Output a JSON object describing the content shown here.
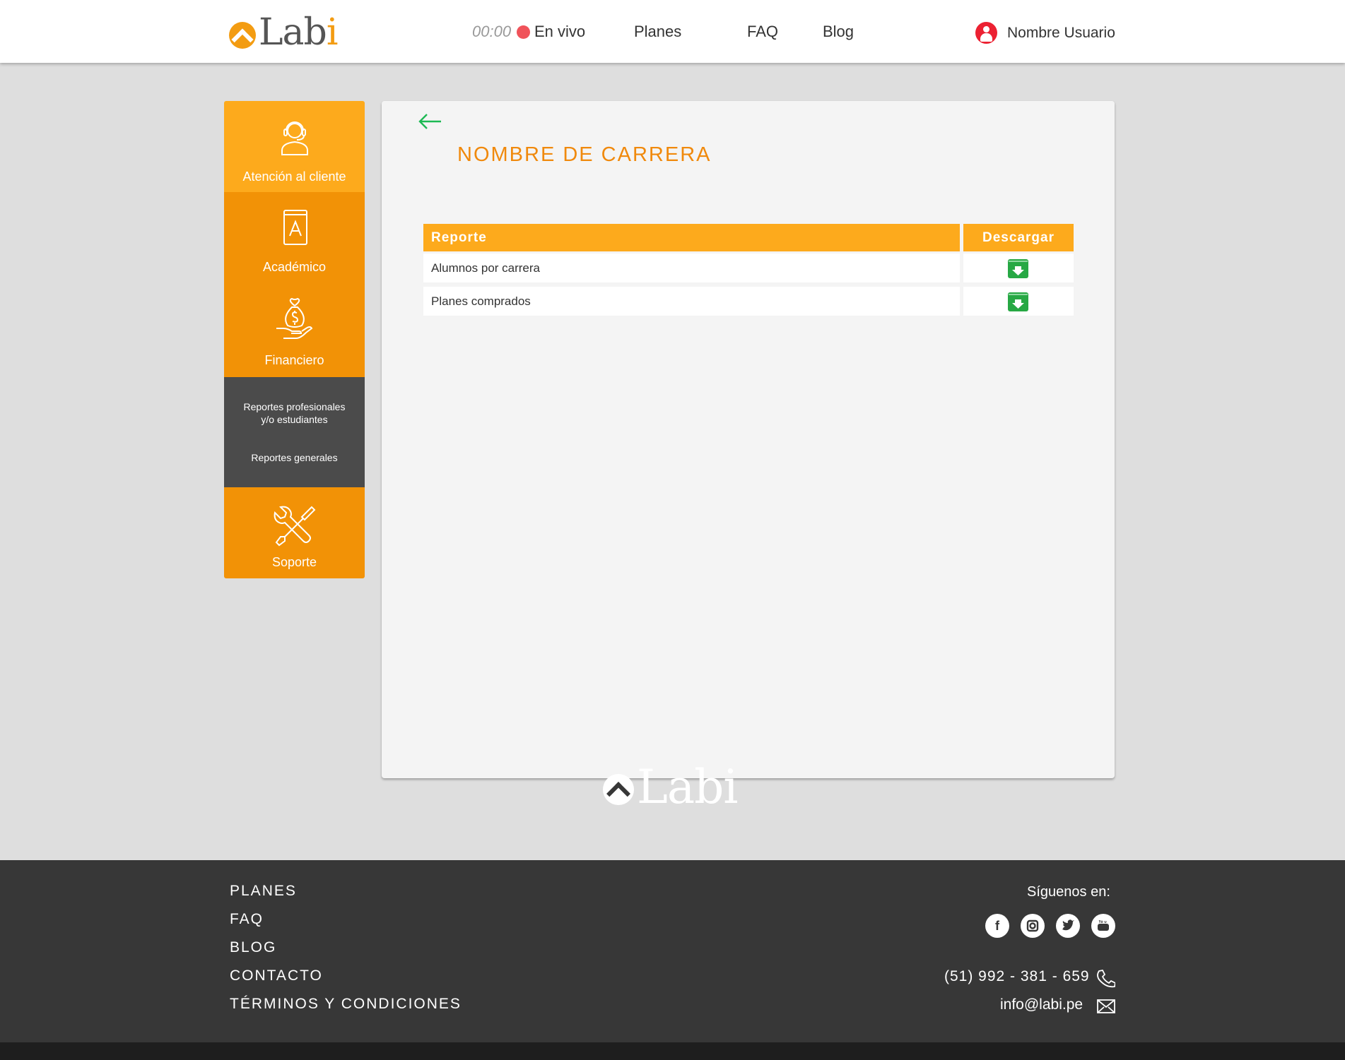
{
  "header": {
    "logo_text_main": "Lab",
    "logo_text_i": "i",
    "timer": "00:00",
    "live_label": "En vivo",
    "nav": [
      "Planes",
      "FAQ",
      "Blog"
    ],
    "user_name": "Nombre Usuario"
  },
  "sidebar": {
    "items": [
      {
        "label": "Atención al cliente",
        "icon": "headset-agent-icon"
      },
      {
        "label": "Académico",
        "icon": "book-icon"
      },
      {
        "label": "Financiero",
        "icon": "money-bag-hand-icon"
      },
      {
        "label": "Soporte",
        "icon": "tools-icon"
      }
    ],
    "submenu": {
      "item1_line1": "Reportes profesionales",
      "item1_line2": "y/o estudiantes",
      "item2": "Reportes generales"
    }
  },
  "main": {
    "title": "NOMBRE DE CARRERA",
    "table": {
      "headers": [
        "Reporte",
        "Descargar"
      ],
      "rows": [
        "Alumnos por carrera",
        "Planes comprados"
      ]
    }
  },
  "footer": {
    "links": [
      "PLANES",
      "FAQ",
      "BLOG",
      "CONTACTO",
      "TÉRMINOS Y CONDICIONES"
    ],
    "logo_text": "Labi",
    "follow_label": "Síguenos en:",
    "social": [
      "facebook-icon",
      "instagram-icon",
      "twitter-icon",
      "youtube-icon"
    ],
    "phone": "(51) 992 - 381 - 659",
    "email": "info@labi.pe"
  },
  "colors": {
    "orange_light": "#fdaa1c",
    "orange": "#f29206",
    "title_orange": "#f0890c",
    "dark_submenu": "#4b4b4b",
    "download_green": "#27a844",
    "live_red": "#f0535a",
    "footer_bg": "#373737"
  }
}
